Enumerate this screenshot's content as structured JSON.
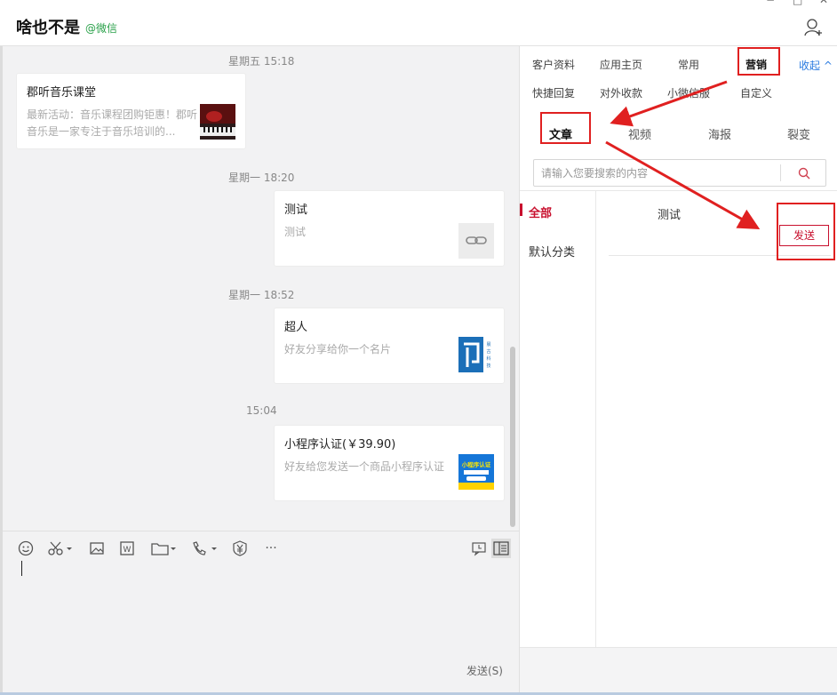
{
  "header": {
    "title": "啥也不是",
    "source": "@微信",
    "window_minimize": "−",
    "window_maximize": "□",
    "window_close": "✕"
  },
  "chat": {
    "messages": [
      {
        "time": "星期五 15:18",
        "title": "郡听音乐课堂",
        "desc": "最新活动：音乐课程团购钜惠！郡听音乐是一家专注于音乐培训的..."
      },
      {
        "time": "星期一 18:20",
        "title": "测试",
        "desc": "测试"
      },
      {
        "time": "星期一 18:52",
        "title": "超人",
        "desc": "好友分享给你一个名片",
        "thumb_text": "晨古科技"
      },
      {
        "time": "15:04",
        "title": "小程序认证(￥39.90)",
        "desc": "好友给您发送一个商品小程序认证",
        "thumb_text": "小程序认证"
      }
    ]
  },
  "toolbar": {
    "send_label": "发送(S)",
    "more": "···"
  },
  "panel": {
    "tabs_row1": [
      "客户资料",
      "应用主页",
      "常用",
      "营销"
    ],
    "tabs_row2": [
      "快捷回复",
      "对外收款",
      "小微信服",
      "自定义"
    ],
    "collapse": "收起 ^",
    "subtabs": [
      "文章",
      "视频",
      "海报",
      "裂变"
    ],
    "search_placeholder": "请输入您要搜索的内容",
    "categories": [
      "全部",
      "默认分类"
    ],
    "article_title": "测试",
    "send_small": "发送"
  },
  "colors": {
    "accent_red": "#c8102e",
    "annotation_red": "#e02020",
    "link_blue": "#2b7be0",
    "wechat_green": "#2aa14a"
  }
}
